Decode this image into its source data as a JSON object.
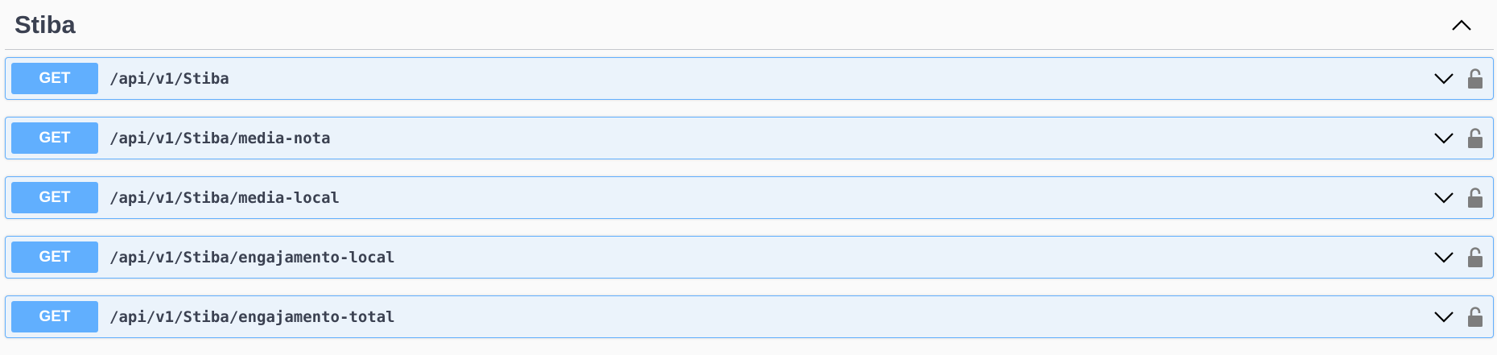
{
  "tag": {
    "title": "Stiba",
    "collapse_icon": "chevron-up-icon"
  },
  "operations": [
    {
      "method": "GET",
      "path": "/api/v1/Stiba",
      "expand_icon": "chevron-down-icon",
      "auth_icon": "unlocked-icon"
    },
    {
      "method": "GET",
      "path": "/api/v1/Stiba/media-nota",
      "expand_icon": "chevron-down-icon",
      "auth_icon": "unlocked-icon"
    },
    {
      "method": "GET",
      "path": "/api/v1/Stiba/media-local",
      "expand_icon": "chevron-down-icon",
      "auth_icon": "unlocked-icon"
    },
    {
      "method": "GET",
      "path": "/api/v1/Stiba/engajamento-local",
      "expand_icon": "chevron-down-icon",
      "auth_icon": "unlocked-icon"
    },
    {
      "method": "GET",
      "path": "/api/v1/Stiba/engajamento-total",
      "expand_icon": "chevron-down-icon",
      "auth_icon": "unlocked-icon"
    }
  ],
  "colors": {
    "get_accent": "#61affe",
    "get_background": "#ebf3fb",
    "text": "#3b4151",
    "icon_gray": "#7d7d7d"
  }
}
